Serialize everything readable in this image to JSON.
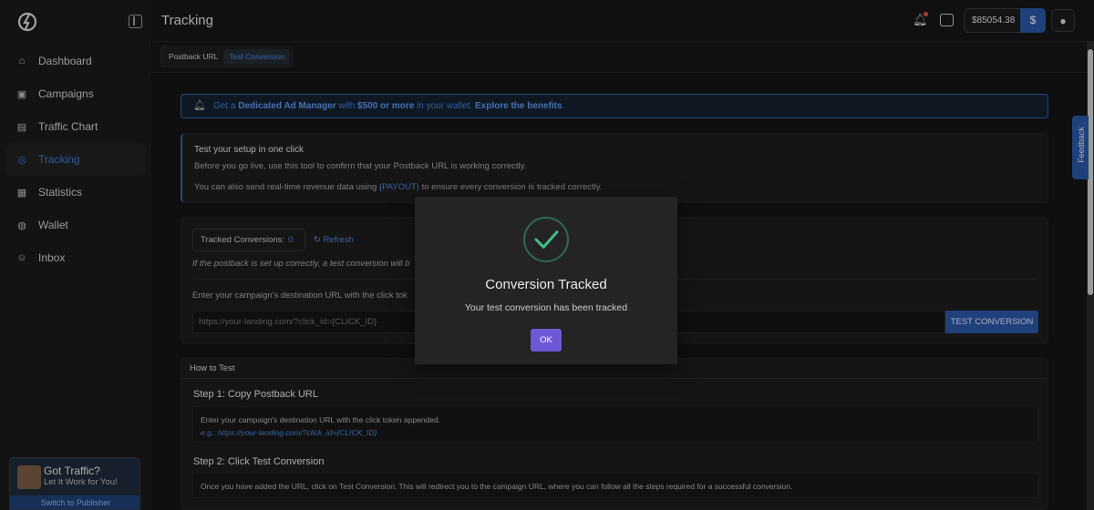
{
  "app": {
    "title": "Tracking"
  },
  "sidebar": {
    "items": [
      {
        "label": "Dashboard",
        "icon": "home-icon"
      },
      {
        "label": "Campaigns",
        "icon": "ad-icon"
      },
      {
        "label": "Traffic Chart",
        "icon": "chart-icon"
      },
      {
        "label": "Tracking",
        "icon": "target-icon",
        "active": true
      },
      {
        "label": "Statistics",
        "icon": "stats-icon"
      },
      {
        "label": "Wallet",
        "icon": "wallet-icon"
      },
      {
        "label": "Inbox",
        "icon": "inbox-icon"
      }
    ],
    "promo": {
      "title": "Got Traffic?",
      "subtitle": "Let It Work for You!",
      "button": "Switch to Publisher"
    }
  },
  "header": {
    "balance": "$85054.38"
  },
  "tabs": [
    {
      "label": "Postback URL",
      "active": false
    },
    {
      "label": "Test Conversion",
      "active": true
    }
  ],
  "banner": {
    "p1": "Get a ",
    "b1": "Dedicated Ad Manager",
    "p2": " with ",
    "b2": "$500 or more",
    "p3": " in your wallet. ",
    "link": "Explore the benefits",
    "p4": "."
  },
  "intro": {
    "title": "Test your setup in one click",
    "text": "Before you go live, use this tool to confirm that your Postback URL is working correctly.",
    "text2_a": "You can also send real-time revenue data using ",
    "text2_token": "{PAYOUT}",
    "text2_b": " to ensure every conversion is tracked correctly."
  },
  "tester": {
    "tracked_label": "Tracked Conversions:",
    "tracked_count": "0",
    "refresh": "Refresh",
    "hint": "If the postback is set up correctly, a test conversion will b",
    "dest_label": "Enter your campaign's destination URL with the click tok",
    "url_placeholder": "https://your-landing.com/?click_id={CLICK_ID}",
    "button": "TEST CONVERSION"
  },
  "howto": {
    "header": "How to Test",
    "step1_title": "Step 1: Copy Postback URL",
    "step1_text": "Enter your campaign's destination URL with the click token appended.",
    "step1_eg": "e.g.: https://your-landing.com/?click_id={CLICK_ID}",
    "step2_title": "Step 2: Click Test Conversion",
    "step2_text": "Once you have added the URL, click on Test Conversion. This will redirect you to the campaign URL, where you can follow all the steps required for a successful conversion."
  },
  "feedback": "Feedback",
  "modal": {
    "title": "Conversion Tracked",
    "text": "Your test conversion has been tracked",
    "ok": "OK"
  },
  "colors": {
    "accent": "#2a56a5",
    "link": "#4a86e0",
    "modal_button": "#6f58d8",
    "success": "#3fbf8a"
  }
}
